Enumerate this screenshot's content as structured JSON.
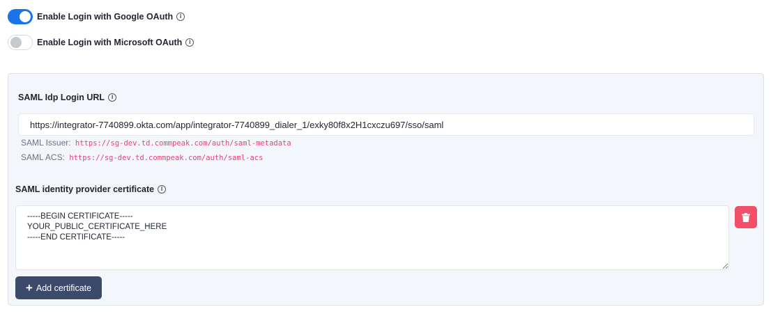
{
  "oauth": {
    "google": {
      "label": "Enable Login with Google OAuth",
      "enabled": true
    },
    "microsoft": {
      "label": "Enable Login with Microsoft OAuth",
      "enabled": false
    }
  },
  "saml": {
    "login_url_label": "SAML Idp Login URL",
    "login_url_value": "https://integrator-7740899.okta.com/app/integrator-7740899_dialer_1/exky80f8x2H1cxczu697/sso/saml",
    "issuer_label": "SAML Issuer:",
    "issuer_value": "https://sg-dev.td.commpeak.com/auth/saml-metadata",
    "acs_label": "SAML ACS:",
    "acs_value": "https://sg-dev.td.commpeak.com/auth/saml-acs",
    "certificate_label": "SAML identity provider certificate",
    "certificate_value": "-----BEGIN CERTIFICATE-----\nYOUR_PUBLIC_CERTIFICATE_HERE\n-----END CERTIFICATE-----",
    "add_certificate_label": "Add certificate"
  },
  "icons": {
    "info": "info-icon",
    "delete": "trash-icon",
    "add": "plus-icon"
  },
  "colors": {
    "toggle_on": "#1a73e8",
    "delete_button": "#f25068",
    "add_button": "#3b4a6b",
    "code_text": "#e0457b"
  }
}
